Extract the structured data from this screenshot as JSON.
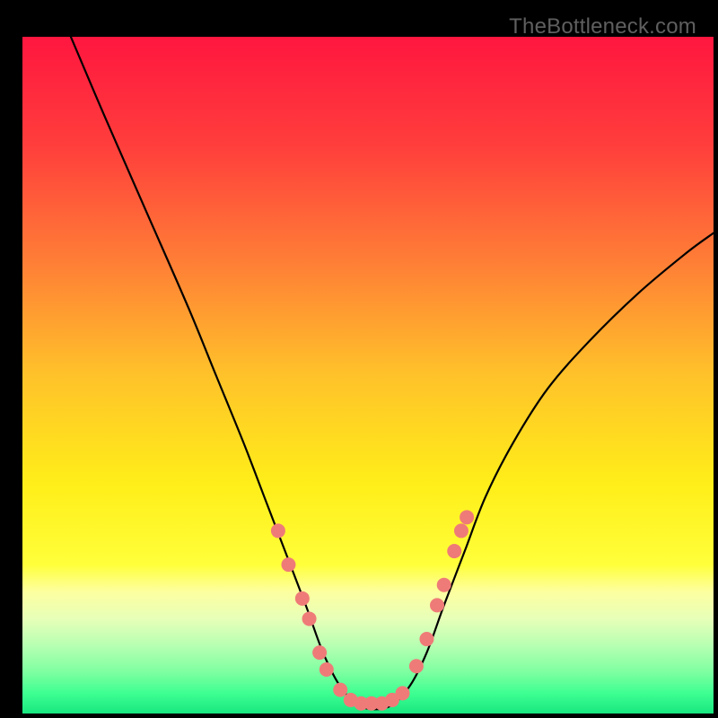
{
  "watermark": "TheBottleneck.com",
  "chart_data": {
    "type": "line",
    "title": "",
    "xlabel": "",
    "ylabel": "",
    "xlim": [
      0,
      100
    ],
    "ylim": [
      0,
      100
    ],
    "gradient_stops": [
      {
        "offset": 0.0,
        "color": "#ff163f"
      },
      {
        "offset": 0.16,
        "color": "#ff3e3c"
      },
      {
        "offset": 0.33,
        "color": "#ff7d36"
      },
      {
        "offset": 0.5,
        "color": "#ffc22a"
      },
      {
        "offset": 0.66,
        "color": "#ffee19"
      },
      {
        "offset": 0.78,
        "color": "#ffff3a"
      },
      {
        "offset": 0.82,
        "color": "#fdffa0"
      },
      {
        "offset": 0.86,
        "color": "#e7ffb8"
      },
      {
        "offset": 0.9,
        "color": "#b6ffb2"
      },
      {
        "offset": 0.94,
        "color": "#7cffa0"
      },
      {
        "offset": 0.97,
        "color": "#3eff92"
      },
      {
        "offset": 1.0,
        "color": "#18e77f"
      }
    ],
    "series": [
      {
        "name": "bottleneck-curve",
        "x": [
          7,
          12,
          18,
          24,
          28,
          32,
          35,
          38,
          41,
          43.5,
          46,
          49,
          53,
          56,
          58.5,
          61,
          64,
          67,
          71,
          76,
          82,
          89,
          96,
          100
        ],
        "y": [
          100,
          88,
          74,
          60,
          50,
          40,
          32,
          24,
          16,
          9,
          4,
          1,
          1,
          4,
          9,
          16,
          24,
          32,
          40,
          48,
          55,
          62,
          68,
          71
        ]
      }
    ],
    "markers": {
      "name": "highlight-dots",
      "color": "#ef7b78",
      "radius": 8,
      "points": [
        {
          "x": 37.0,
          "y": 27
        },
        {
          "x": 38.5,
          "y": 22
        },
        {
          "x": 40.5,
          "y": 17
        },
        {
          "x": 41.5,
          "y": 14
        },
        {
          "x": 43.0,
          "y": 9
        },
        {
          "x": 44.0,
          "y": 6.5
        },
        {
          "x": 46.0,
          "y": 3.5
        },
        {
          "x": 47.5,
          "y": 2
        },
        {
          "x": 49.0,
          "y": 1.5
        },
        {
          "x": 50.5,
          "y": 1.5
        },
        {
          "x": 52.0,
          "y": 1.5
        },
        {
          "x": 53.5,
          "y": 2
        },
        {
          "x": 55.0,
          "y": 3
        },
        {
          "x": 57.0,
          "y": 7
        },
        {
          "x": 58.5,
          "y": 11
        },
        {
          "x": 60.0,
          "y": 16
        },
        {
          "x": 61.0,
          "y": 19
        },
        {
          "x": 62.5,
          "y": 24
        },
        {
          "x": 63.5,
          "y": 27
        },
        {
          "x": 64.3,
          "y": 29
        }
      ]
    }
  }
}
